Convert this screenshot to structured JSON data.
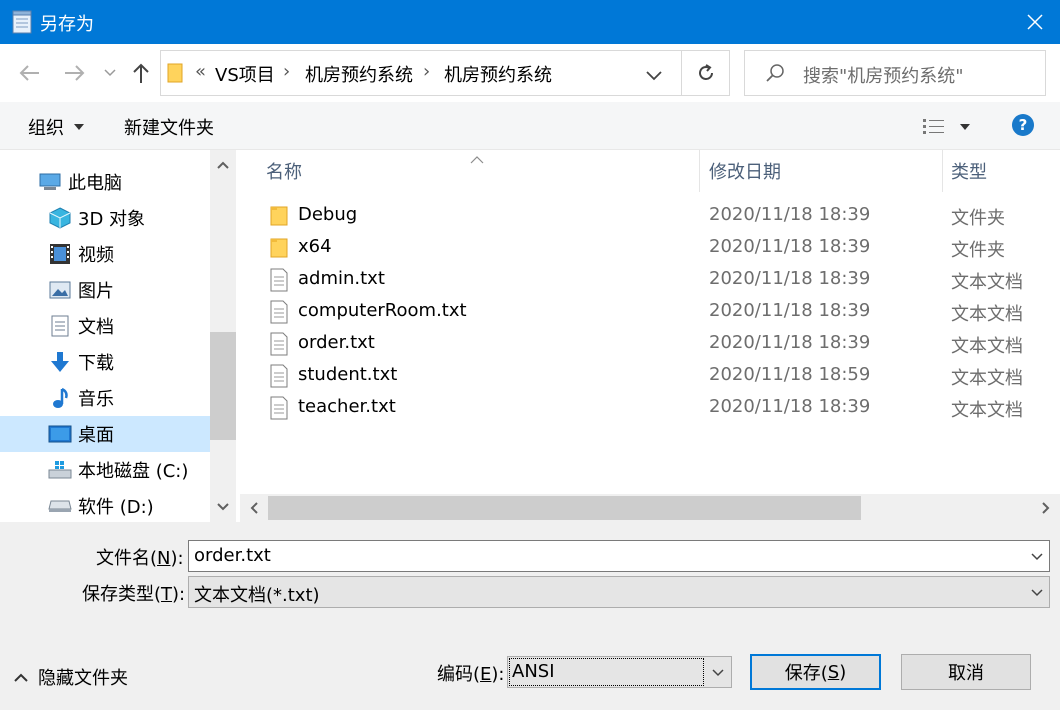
{
  "window": {
    "title": "另存为"
  },
  "nav": {
    "breadcrumb_overflow": "«",
    "breadcrumb": [
      "VS项目",
      "机房预约系统",
      "机房预约系统"
    ],
    "search_placeholder": "搜索\"机房预约系统\""
  },
  "toolbar": {
    "organize": "组织",
    "new_folder": "新建文件夹"
  },
  "sidebar": {
    "items": [
      {
        "label": "此电脑",
        "icon": "computer-icon"
      },
      {
        "label": "3D 对象",
        "icon": "3d-objects-icon"
      },
      {
        "label": "视频",
        "icon": "videos-icon"
      },
      {
        "label": "图片",
        "icon": "pictures-icon"
      },
      {
        "label": "文档",
        "icon": "documents-icon"
      },
      {
        "label": "下载",
        "icon": "downloads-icon"
      },
      {
        "label": "音乐",
        "icon": "music-icon"
      },
      {
        "label": "桌面",
        "icon": "desktop-icon",
        "selected": true
      },
      {
        "label": "本地磁盘 (C:)",
        "icon": "windows-drive-icon"
      },
      {
        "label": "软件 (D:)",
        "icon": "drive-icon"
      }
    ]
  },
  "columns": {
    "name": "名称",
    "date": "修改日期",
    "type": "类型"
  },
  "files": [
    {
      "name": "Debug",
      "date": "2020/11/18 18:39",
      "type": "文件夹",
      "kind": "folder"
    },
    {
      "name": "x64",
      "date": "2020/11/18 18:39",
      "type": "文件夹",
      "kind": "folder"
    },
    {
      "name": "admin.txt",
      "date": "2020/11/18 18:39",
      "type": "文本文档",
      "kind": "txt"
    },
    {
      "name": "computerRoom.txt",
      "date": "2020/11/18 18:39",
      "type": "文本文档",
      "kind": "txt"
    },
    {
      "name": "order.txt",
      "date": "2020/11/18 18:39",
      "type": "文本文档",
      "kind": "txt"
    },
    {
      "name": "student.txt",
      "date": "2020/11/18 18:59",
      "type": "文本文档",
      "kind": "txt"
    },
    {
      "name": "teacher.txt",
      "date": "2020/11/18 18:39",
      "type": "文本文档",
      "kind": "txt"
    }
  ],
  "form": {
    "filename_label_pre": "文件名(",
    "filename_label_key": "N",
    "filename_label_post": "):",
    "filename_value": "order.txt",
    "filetype_label_pre": "保存类型(",
    "filetype_label_key": "T",
    "filetype_label_post": "):",
    "filetype_value": "文本文档(*.txt)",
    "hide_folders": "隐藏文件夹",
    "encoding_label_pre": "编码(",
    "encoding_label_key": "E",
    "encoding_label_post": "):",
    "encoding_value": "ANSI",
    "save_pre": "保存(",
    "save_key": "S",
    "save_post": ")",
    "cancel": "取消"
  },
  "colors": {
    "titlebar": "#0078d7",
    "selection": "#cce8ff",
    "help": "#1979ca"
  }
}
